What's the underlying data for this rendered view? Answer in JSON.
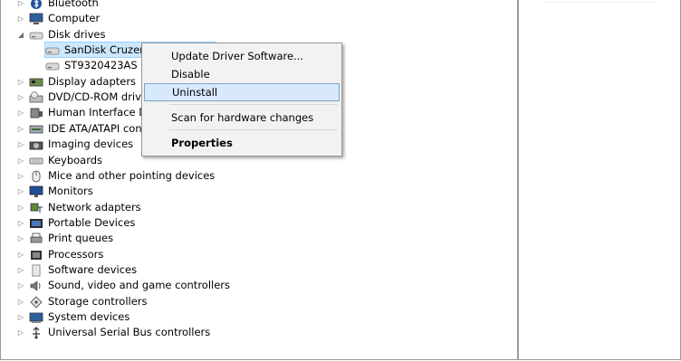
{
  "tree": {
    "items": [
      {
        "label": "Bluetooth",
        "indent": 0,
        "arrow": "▷",
        "icon": "bluetooth-icon"
      },
      {
        "label": "Computer",
        "indent": 0,
        "arrow": "▷",
        "icon": "computer-icon"
      },
      {
        "label": "Disk drives",
        "indent": 0,
        "arrow": "◢",
        "icon": "disk-drive-icon"
      },
      {
        "label": "SanDisk Cruzer Fit USB Device",
        "indent": 1,
        "arrow": "",
        "icon": "disk-drive-icon",
        "selected": true
      },
      {
        "label": "ST9320423AS",
        "indent": 1,
        "arrow": "",
        "icon": "disk-drive-icon"
      },
      {
        "label": "Display adapters",
        "indent": 0,
        "arrow": "▷",
        "icon": "display-adapter-icon"
      },
      {
        "label": "DVD/CD-ROM drives",
        "indent": 0,
        "arrow": "▷",
        "icon": "dvd-icon"
      },
      {
        "label": "Human Interface Devices",
        "indent": 0,
        "arrow": "▷",
        "icon": "hid-icon"
      },
      {
        "label": "IDE ATA/ATAPI controllers",
        "indent": 0,
        "arrow": "▷",
        "icon": "ide-controller-icon"
      },
      {
        "label": "Imaging devices",
        "indent": 0,
        "arrow": "▷",
        "icon": "camera-icon"
      },
      {
        "label": "Keyboards",
        "indent": 0,
        "arrow": "▷",
        "icon": "keyboard-icon"
      },
      {
        "label": "Mice and other pointing devices",
        "indent": 0,
        "arrow": "▷",
        "icon": "mouse-icon"
      },
      {
        "label": "Monitors",
        "indent": 0,
        "arrow": "▷",
        "icon": "monitor-icon"
      },
      {
        "label": "Network adapters",
        "indent": 0,
        "arrow": "▷",
        "icon": "network-icon"
      },
      {
        "label": "Portable Devices",
        "indent": 0,
        "arrow": "▷",
        "icon": "portable-device-icon"
      },
      {
        "label": "Print queues",
        "indent": 0,
        "arrow": "▷",
        "icon": "printer-icon"
      },
      {
        "label": "Processors",
        "indent": 0,
        "arrow": "▷",
        "icon": "processor-icon"
      },
      {
        "label": "Software devices",
        "indent": 0,
        "arrow": "▷",
        "icon": "software-device-icon"
      },
      {
        "label": "Sound, video and game controllers",
        "indent": 0,
        "arrow": "▷",
        "icon": "speaker-icon"
      },
      {
        "label": "Storage controllers",
        "indent": 0,
        "arrow": "▷",
        "icon": "storage-icon"
      },
      {
        "label": "System devices",
        "indent": 0,
        "arrow": "▷",
        "icon": "system-device-icon"
      },
      {
        "label": "Universal Serial Bus controllers",
        "indent": 0,
        "arrow": "▷",
        "icon": "usb-icon"
      }
    ]
  },
  "context_menu": {
    "items": [
      {
        "label": "Update Driver Software...",
        "type": "item",
        "name": "update-driver-menu-item"
      },
      {
        "label": "Disable",
        "type": "item",
        "name": "disable-menu-item"
      },
      {
        "label": "Uninstall",
        "type": "item",
        "name": "uninstall-menu-item",
        "highlighted": true
      },
      {
        "type": "separator"
      },
      {
        "label": "Scan for hardware changes",
        "type": "item",
        "name": "scan-hardware-menu-item"
      },
      {
        "type": "separator"
      },
      {
        "label": "Properties",
        "type": "item",
        "name": "properties-menu-item",
        "bold": true
      }
    ]
  },
  "colors": {
    "selection_bg": "#cce8ff",
    "menu_bg": "#f2f2f2",
    "menu_highlight": "#d8e9fb"
  }
}
